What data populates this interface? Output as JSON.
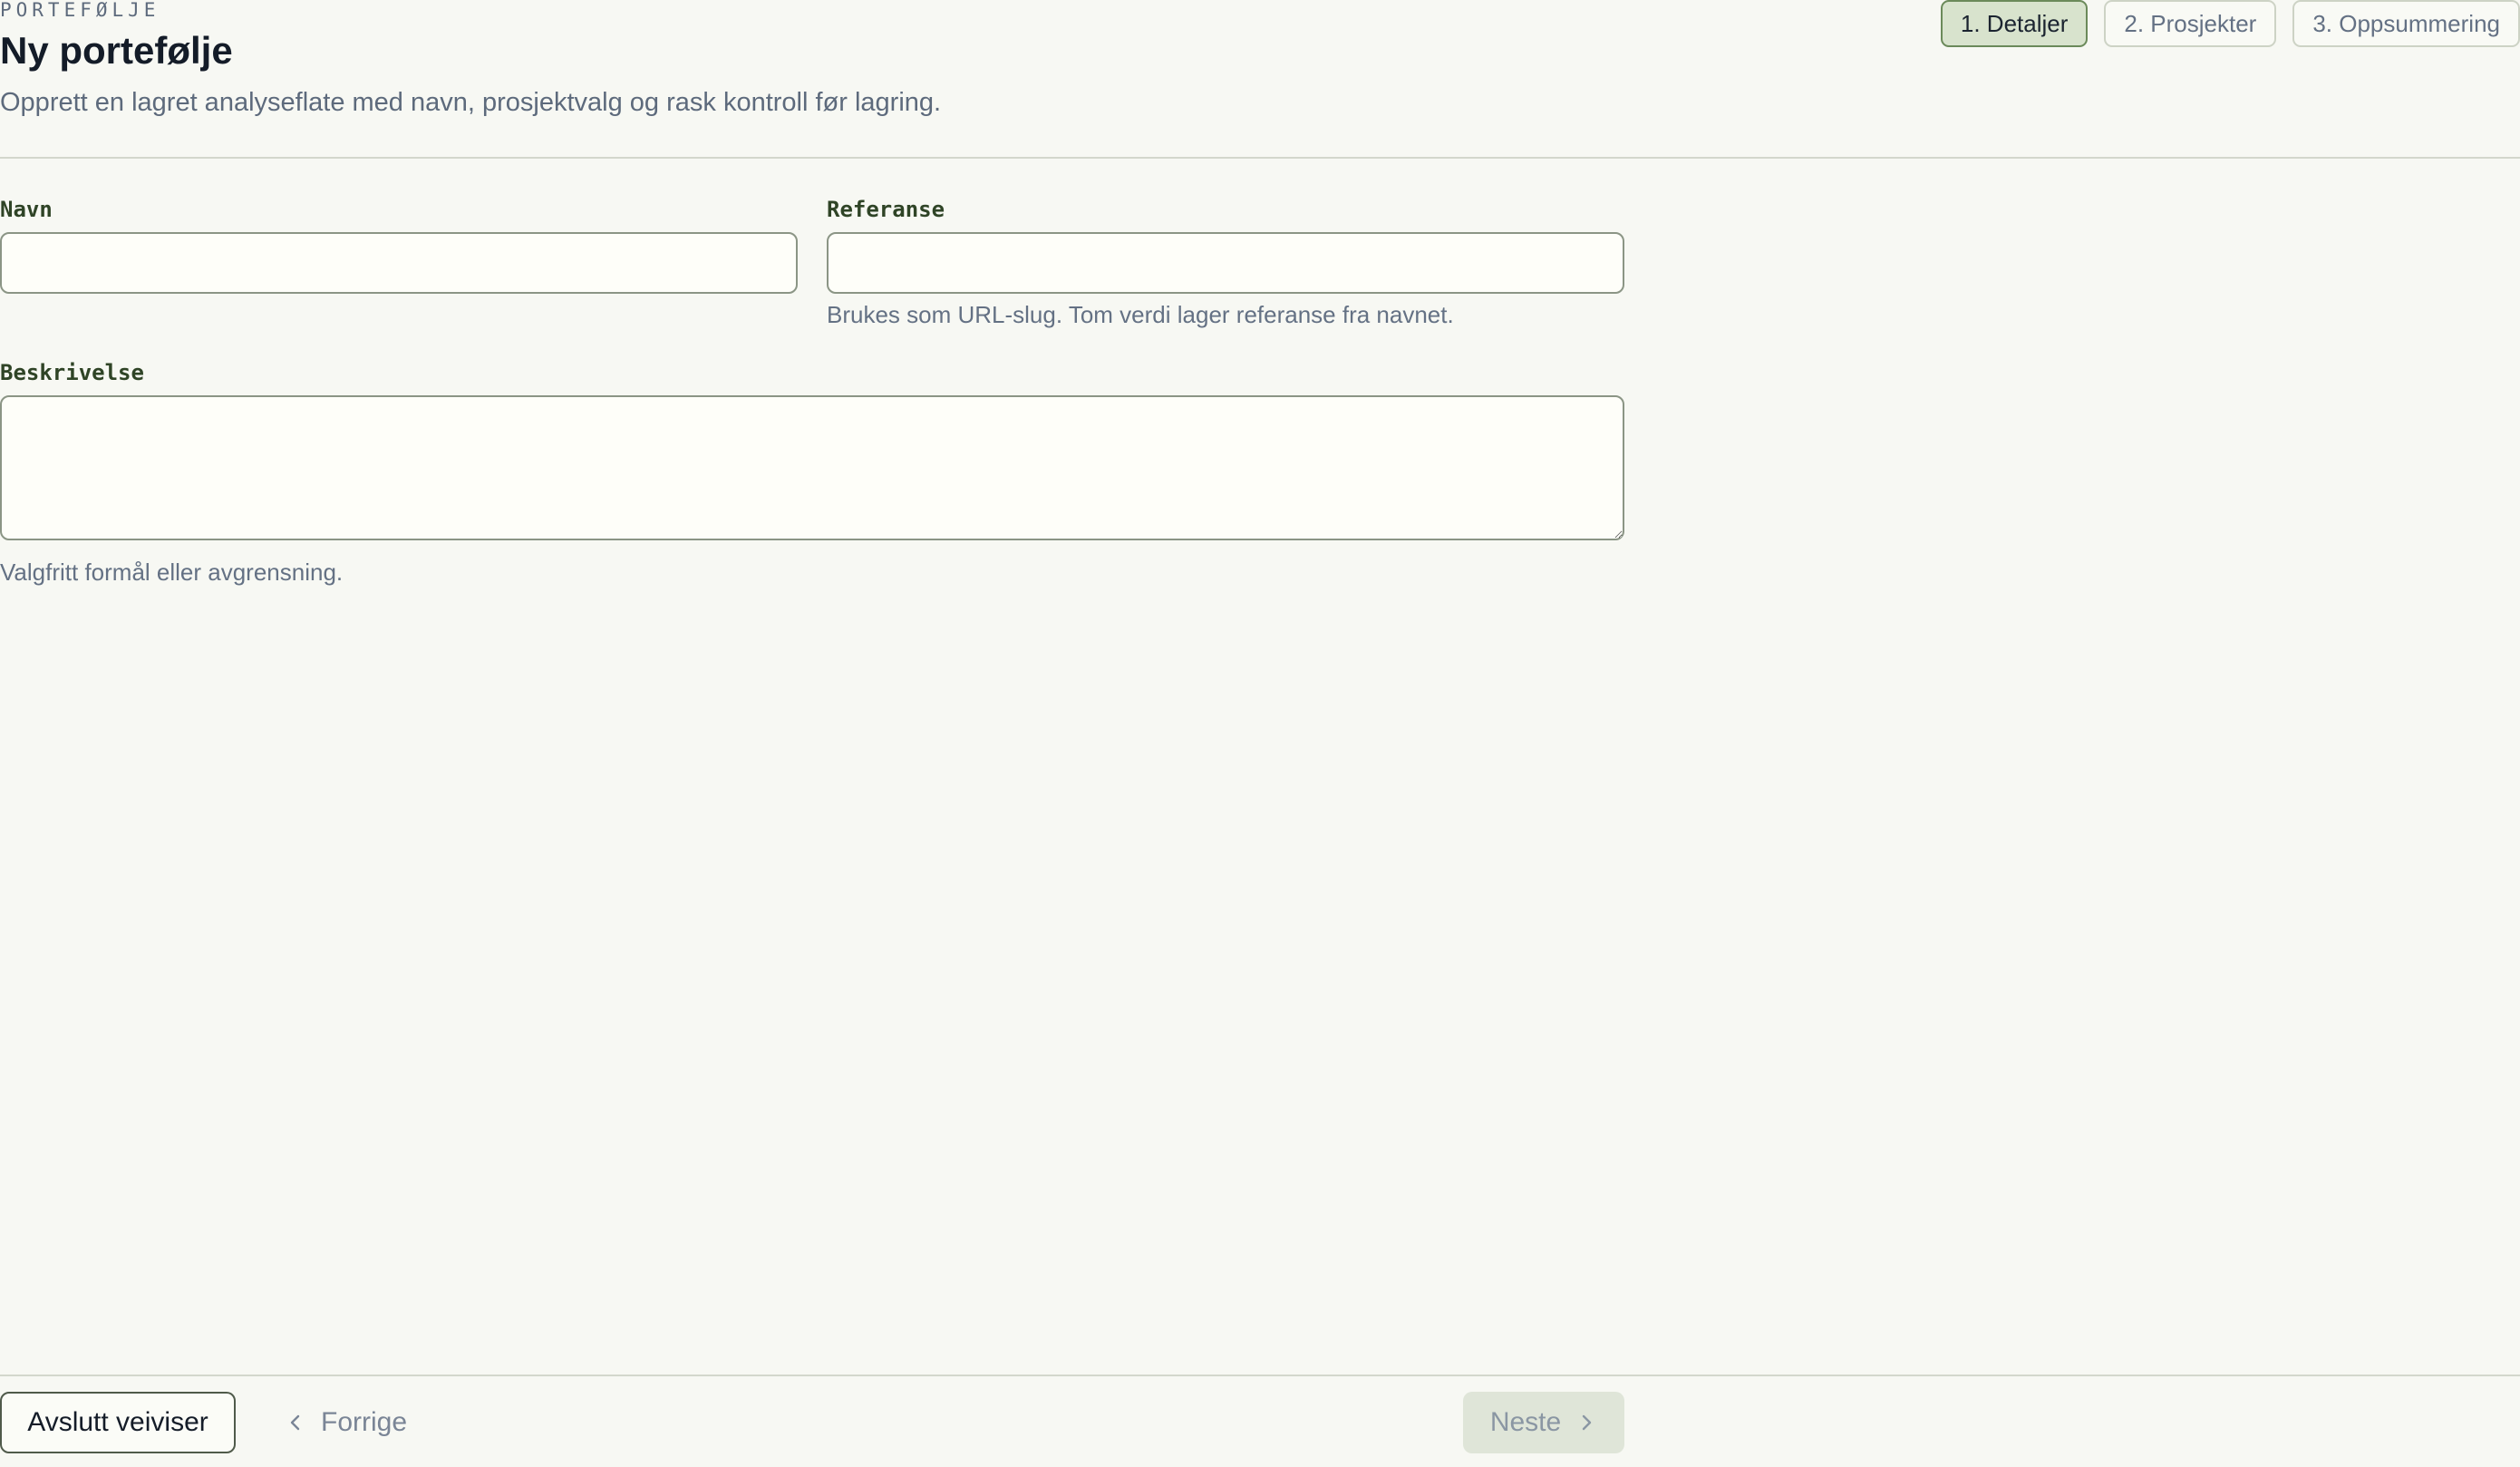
{
  "header": {
    "eyebrow": "PORTEFØLJE",
    "title": "Ny portefølje",
    "subtitle": "Opprett en lagret analyseflate med navn, prosjektvalg og rask kontroll før lagring."
  },
  "steps": [
    {
      "label": "1. Detaljer",
      "active": true
    },
    {
      "label": "2. Prosjekter",
      "active": false
    },
    {
      "label": "3. Oppsummering",
      "active": false
    }
  ],
  "form": {
    "name": {
      "label": "Navn",
      "value": "",
      "placeholder": ""
    },
    "reference": {
      "label": "Referanse",
      "value": "",
      "placeholder": "",
      "hint": "Brukes som URL-slug. Tom verdi lager referanse fra navnet."
    },
    "description": {
      "label": "Beskrivelse",
      "value": "",
      "placeholder": "",
      "hint": "Valgfritt formål eller avgrensning."
    }
  },
  "footer": {
    "exit_label": "Avslutt veiviser",
    "prev_label": "Forrige",
    "next_label": "Neste"
  },
  "icons": {
    "prev": "chevron-left-icon",
    "next": "chevron-right-icon"
  },
  "colors": {
    "background": "#f7f8f3",
    "active_step_bg": "#d8e3cd",
    "active_step_border": "#6b8a5a",
    "label_green": "#2f4426",
    "muted_text": "#5d6a7c",
    "disabled_button_bg": "#dfe5d8"
  }
}
